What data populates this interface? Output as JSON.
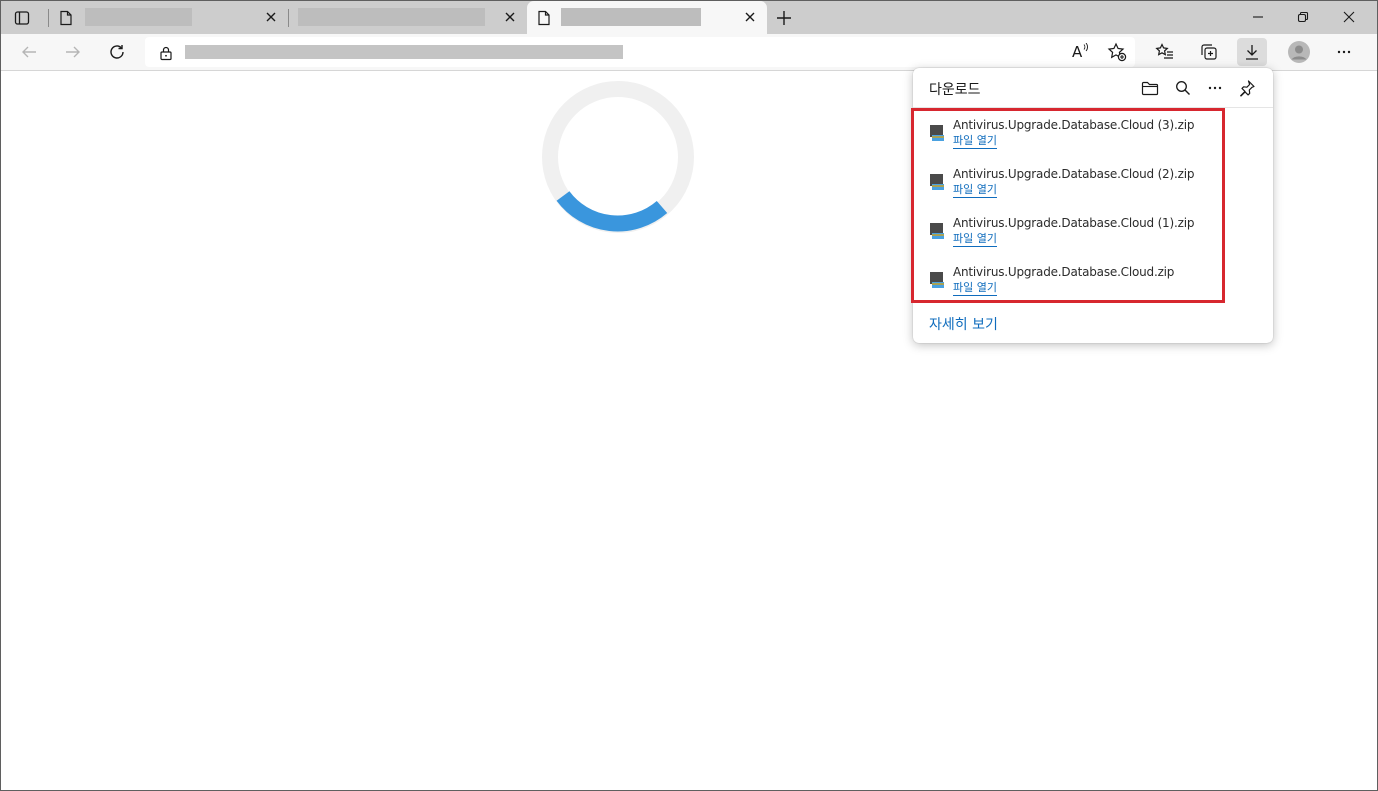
{
  "tabs": [
    {
      "title": "",
      "active": false
    },
    {
      "title": "",
      "active": false
    },
    {
      "title": "",
      "active": true
    }
  ],
  "address_bar": {
    "url": "",
    "read_aloud_label": "A"
  },
  "downloads": {
    "title": "다운로드",
    "items": [
      {
        "filename": "Antivirus.Upgrade.Database.Cloud (3).zip",
        "action": "파일 열기"
      },
      {
        "filename": "Antivirus.Upgrade.Database.Cloud (2).zip",
        "action": "파일 열기"
      },
      {
        "filename": "Antivirus.Upgrade.Database.Cloud (1).zip",
        "action": "파일 열기"
      },
      {
        "filename": "Antivirus.Upgrade.Database.Cloud.zip",
        "action": "파일 열기"
      }
    ],
    "see_more": "자세히 보기",
    "icons": [
      "folder-icon",
      "search-icon",
      "more-icon",
      "pin-icon"
    ]
  },
  "page": {
    "loading": true
  },
  "colors": {
    "accent": "#0f6cbd",
    "spinner": "#3a96dd",
    "highlight": "#d7272f",
    "tabstrip": "#cdcdcd",
    "toolbar": "#f7f7f7"
  }
}
